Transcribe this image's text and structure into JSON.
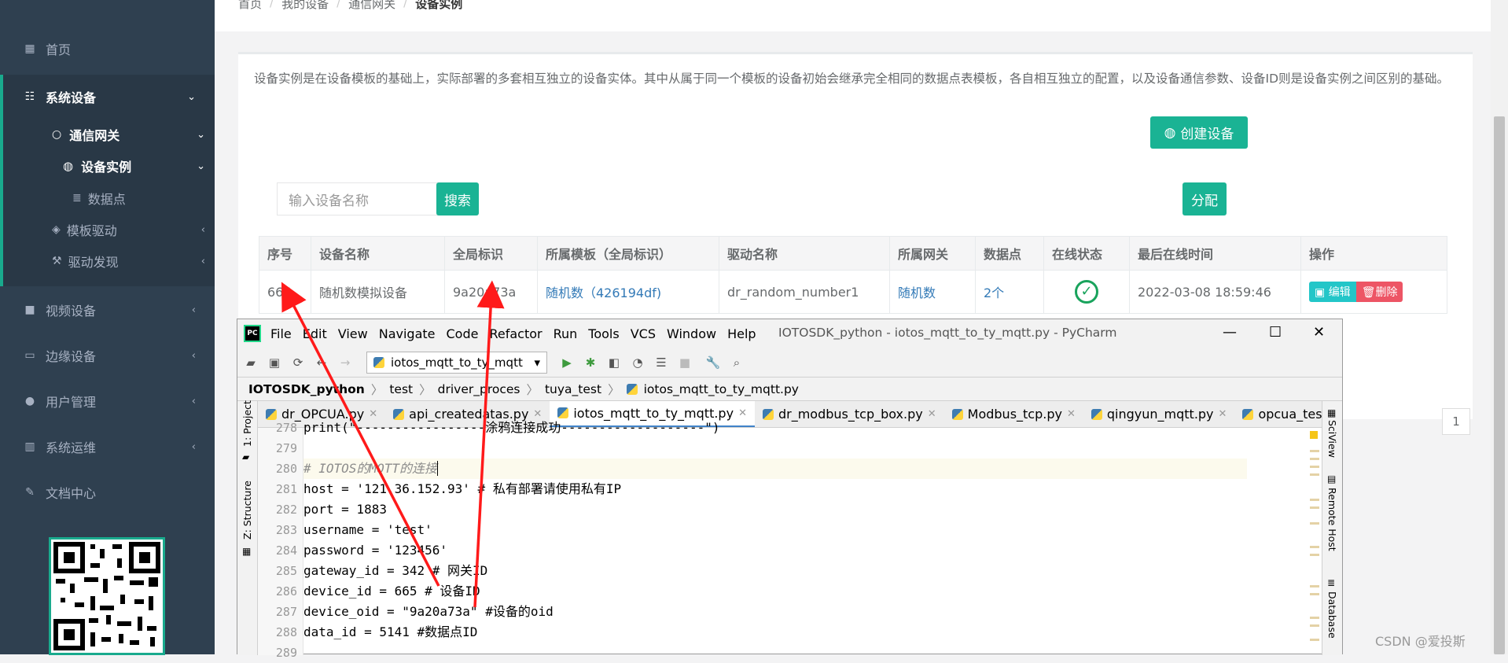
{
  "sidebar": {
    "items": [
      {
        "label": "首页",
        "icon": "grid-icon"
      },
      {
        "label": "系统设备",
        "icon": "sitemap-icon"
      },
      {
        "label": "视频设备",
        "icon": "video-camera-icon"
      },
      {
        "label": "边缘设备",
        "icon": "laptop-icon"
      },
      {
        "label": "用户管理",
        "icon": "user-icon"
      },
      {
        "label": "系统运维",
        "icon": "bar-chart-icon"
      },
      {
        "label": "文档中心",
        "icon": "edit-icon"
      }
    ],
    "sub_items": [
      {
        "label": "通信网关",
        "icon": "circle-icon"
      },
      {
        "label": "设备实例",
        "icon": "rebel-icon"
      },
      {
        "label": "数据点",
        "icon": "database-icon"
      },
      {
        "label": "模板驱动",
        "icon": "drupal-icon"
      },
      {
        "label": "驱动发现",
        "icon": "gavel-icon"
      }
    ],
    "accent_color": "#19aa8d"
  },
  "breadcrumb": [
    "首页",
    "我的设备",
    "通信网关",
    "设备实例"
  ],
  "intro": "设备实例是在设备模板的基础上，实际部署的多套相互独立的设备实体。其中从属于同一个模板的设备初始会继承完全相同的数据点表模板，各自相互独立的配置，以及设备通信参数、设备ID则是设备实例之间区别的基础。",
  "buttons": {
    "create": "创建设备",
    "search": "搜索",
    "assign": "分配"
  },
  "search": {
    "placeholder": "输入设备名称"
  },
  "table": {
    "headers": [
      "序号",
      "设备名称",
      "全局标识",
      "所属模板（全局标识）",
      "驱动名称",
      "所属网关",
      "数据点",
      "在线状态",
      "最后在线时间",
      "操作"
    ],
    "rows": [
      {
        "id": "665",
        "name": "随机数模拟设备",
        "global_id": "9a20a73a",
        "template": "随机数（426194df)",
        "driver": "dr_random_number1",
        "gateway": "随机数",
        "points": "2个",
        "online": "online",
        "last_online": "2022-03-08 18:59:46",
        "edit": "编辑",
        "delete": "删除"
      }
    ]
  },
  "pagination": {
    "page": "1"
  },
  "pycharm": {
    "menu": [
      "File",
      "Edit",
      "View",
      "Navigate",
      "Code",
      "Refactor",
      "Run",
      "Tools",
      "VCS",
      "Window",
      "Help"
    ],
    "window_title": "IOTOSDK_python - iotos_mqtt_to_ty_mqtt.py - PyCharm",
    "run_config": "iotos_mqtt_to_ty_mqtt",
    "nav": [
      "IOTOSDK_python",
      "test",
      "driver_proces",
      "tuya_test",
      "iotos_mqtt_to_ty_mqtt.py"
    ],
    "tabs": [
      "dr_OPCUA.py",
      "api_createdatas.py",
      "iotos_mqtt_to_ty_mqtt.py",
      "dr_modbus_tcp_box.py",
      "Modbus_tcp.py",
      "qingyun_mqtt.py",
      "opcua_tes"
    ],
    "left_tool_windows": [
      "1: Project",
      "Z: Structure"
    ],
    "right_tool_windows": [
      "SciView",
      "Remote Host",
      "Database"
    ],
    "code_lines": [
      {
        "n": "278",
        "text": "print(\"-----------------涂鸦连接成功-------------------\")"
      },
      {
        "n": "279",
        "text": ""
      },
      {
        "n": "280",
        "text": "# IOTOS的MQTT的连接"
      },
      {
        "n": "281",
        "text": "host = '121.36.152.93' # 私有部署请使用私有IP"
      },
      {
        "n": "282",
        "text": "port = 1883"
      },
      {
        "n": "283",
        "text": "username = 'test'"
      },
      {
        "n": "284",
        "text": "password = '123456'"
      },
      {
        "n": "285",
        "text": "gateway_id = 342 # 网关ID"
      },
      {
        "n": "286",
        "text": "device_id = 665 # 设备ID"
      },
      {
        "n": "287",
        "text": "device_oid = \"9a20a73a\" #设备的oid"
      },
      {
        "n": "288",
        "text": "data_id = 5141 #数据点ID"
      },
      {
        "n": "289",
        "text": ""
      }
    ]
  },
  "watermark": "CSDN @爱投斯"
}
